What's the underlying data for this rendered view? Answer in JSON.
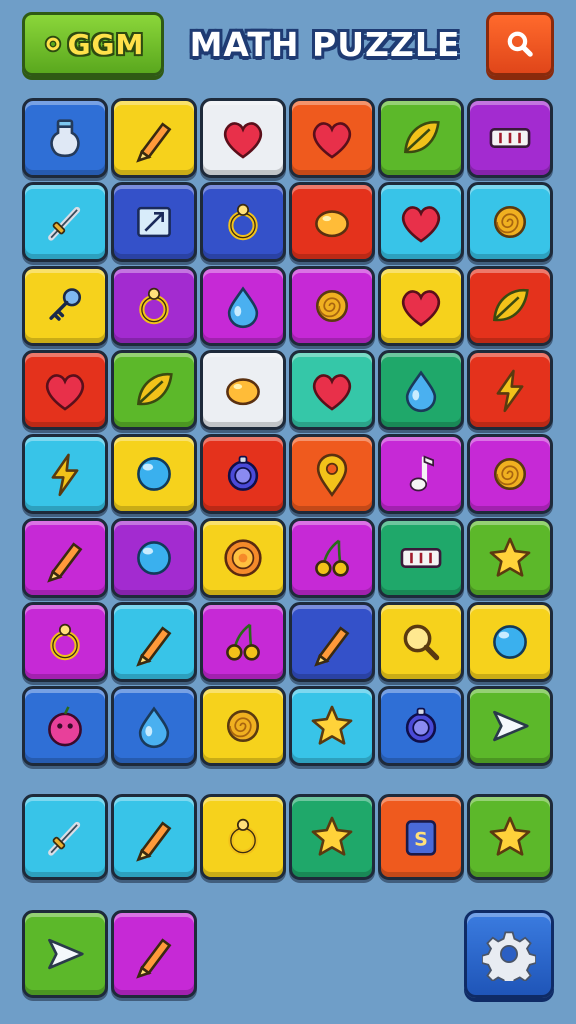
{
  "header": {
    "logo_text": "GGM",
    "title": "MATH PUZZLE",
    "logo_icon": "gear-icon",
    "search_icon": "search-icon"
  },
  "colors": {
    "blue": "#2f6fd6",
    "yellow": "#f6d21c",
    "white": "#eceff3",
    "orange": "#ef5a1e",
    "green": "#5cb82a",
    "purple": "#a32bd0",
    "cyan": "#38c4e8",
    "navy": "#3451c9",
    "red": "#e4321c",
    "magenta": "#c629d6",
    "teal": "#35c7a8",
    "emerald": "#1fa86a"
  },
  "grid": [
    [
      {
        "color": "blue",
        "icon": "potion-icon"
      },
      {
        "color": "yellow",
        "icon": "crayon-icon"
      },
      {
        "color": "white",
        "icon": "heart-icon"
      },
      {
        "color": "orange",
        "icon": "heart-icon"
      },
      {
        "color": "green",
        "icon": "leaf-icon"
      },
      {
        "color": "purple",
        "icon": "counter-icon"
      }
    ],
    [
      {
        "color": "cyan",
        "icon": "sword-icon"
      },
      {
        "color": "navy",
        "icon": "map-icon"
      },
      {
        "color": "navy",
        "icon": "ring-icon"
      },
      {
        "color": "red",
        "icon": "egg-icon"
      },
      {
        "color": "cyan",
        "icon": "heart-icon"
      },
      {
        "color": "cyan",
        "icon": "swirl-icon"
      }
    ],
    [
      {
        "color": "yellow",
        "icon": "key-icon"
      },
      {
        "color": "purple",
        "icon": "ring-icon"
      },
      {
        "color": "magenta",
        "icon": "drop-icon"
      },
      {
        "color": "magenta",
        "icon": "swirl-icon"
      },
      {
        "color": "yellow",
        "icon": "heart-icon"
      },
      {
        "color": "red",
        "icon": "leaf-icon"
      }
    ],
    [
      {
        "color": "red",
        "icon": "heart-icon"
      },
      {
        "color": "green",
        "icon": "leaf-icon"
      },
      {
        "color": "white",
        "icon": "egg-icon"
      },
      {
        "color": "teal",
        "icon": "heart-icon"
      },
      {
        "color": "emerald",
        "icon": "drop-icon"
      },
      {
        "color": "red",
        "icon": "bolt-icon"
      }
    ],
    [
      {
        "color": "cyan",
        "icon": "bolt-icon"
      },
      {
        "color": "yellow",
        "icon": "ball-icon"
      },
      {
        "color": "red",
        "icon": "gem-icon"
      },
      {
        "color": "orange",
        "icon": "pin-icon"
      },
      {
        "color": "magenta",
        "icon": "note-icon"
      },
      {
        "color": "magenta",
        "icon": "swirl-icon"
      }
    ],
    [
      {
        "color": "magenta",
        "icon": "crayon-icon"
      },
      {
        "color": "purple",
        "icon": "ball-icon"
      },
      {
        "color": "yellow",
        "icon": "sun-icon"
      },
      {
        "color": "magenta",
        "icon": "cherry-icon"
      },
      {
        "color": "emerald",
        "icon": "counter-icon"
      },
      {
        "color": "green",
        "icon": "star-icon"
      }
    ],
    [
      {
        "color": "magenta",
        "icon": "ring-icon"
      },
      {
        "color": "cyan",
        "icon": "crayon-icon"
      },
      {
        "color": "magenta",
        "icon": "cherry-icon"
      },
      {
        "color": "navy",
        "icon": "crayon-icon"
      },
      {
        "color": "yellow",
        "icon": "search-icon"
      },
      {
        "color": "yellow",
        "icon": "ball-icon"
      }
    ],
    [
      {
        "color": "blue",
        "icon": "berry-icon"
      },
      {
        "color": "blue",
        "icon": "drop-icon"
      },
      {
        "color": "yellow",
        "icon": "swirl-icon"
      },
      {
        "color": "cyan",
        "icon": "star-icon"
      },
      {
        "color": "blue",
        "icon": "gem-icon"
      },
      {
        "color": "green",
        "icon": "arrow-icon"
      }
    ]
  ],
  "extra_row": [
    {
      "color": "cyan",
      "icon": "sword-icon"
    },
    {
      "color": "cyan",
      "icon": "crayon-icon"
    },
    {
      "color": "yellow",
      "icon": "ring-icon"
    },
    {
      "color": "emerald",
      "icon": "star-icon"
    },
    {
      "color": "orange",
      "icon": "card-icon"
    },
    {
      "color": "green",
      "icon": "star-icon"
    }
  ],
  "bottom_tiles": [
    {
      "color": "green",
      "icon": "arrow-icon"
    },
    {
      "color": "magenta",
      "icon": "crayon-icon"
    }
  ],
  "settings_icon": "gear-icon"
}
